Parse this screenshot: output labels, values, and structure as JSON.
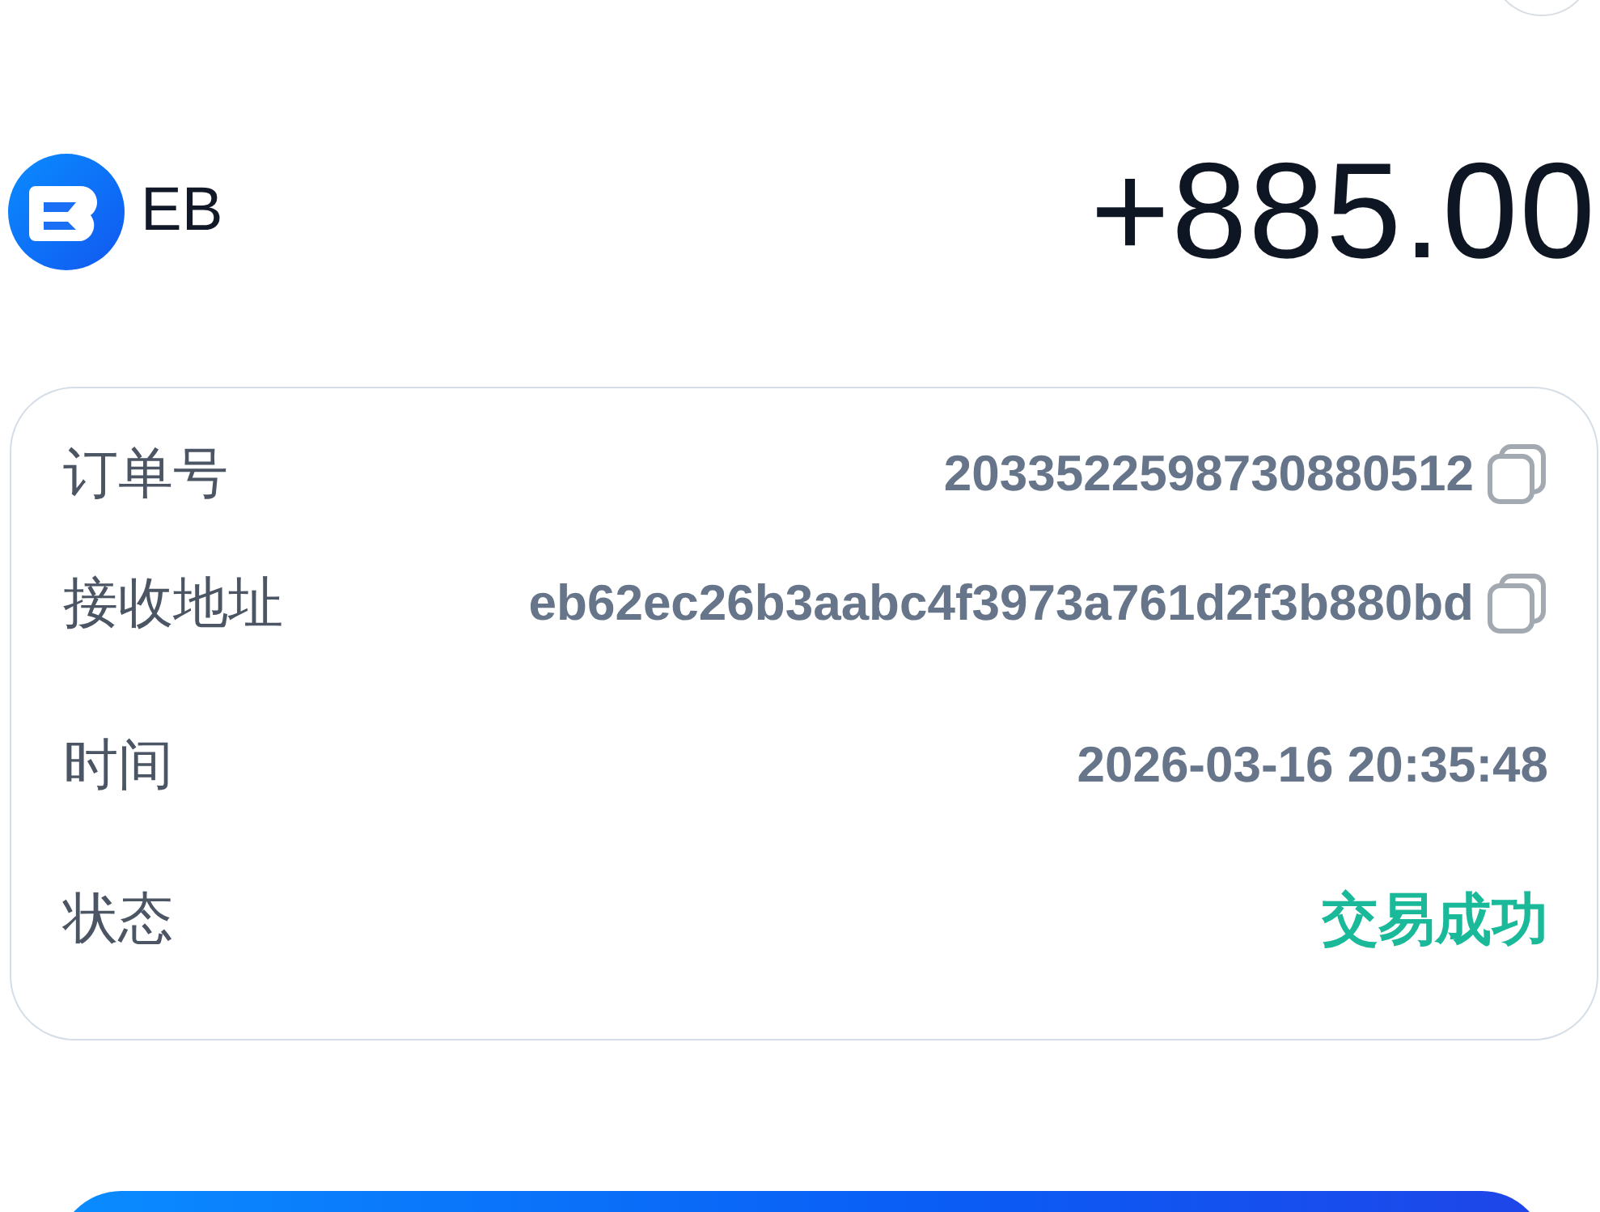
{
  "token": {
    "symbol": "EB",
    "amount": "+885.00"
  },
  "details": [
    {
      "label": "订单号",
      "value": "2033522598730880512",
      "kind": "copy"
    },
    {
      "label": "接收地址",
      "value": "eb62ec26b3aabc4f3973a761d2f3b880bd",
      "kind": "copy"
    },
    {
      "label": "时间",
      "value": "2026-03-16 20:35:48",
      "kind": "text"
    },
    {
      "label": "状态",
      "value": "交易成功",
      "kind": "status"
    }
  ]
}
